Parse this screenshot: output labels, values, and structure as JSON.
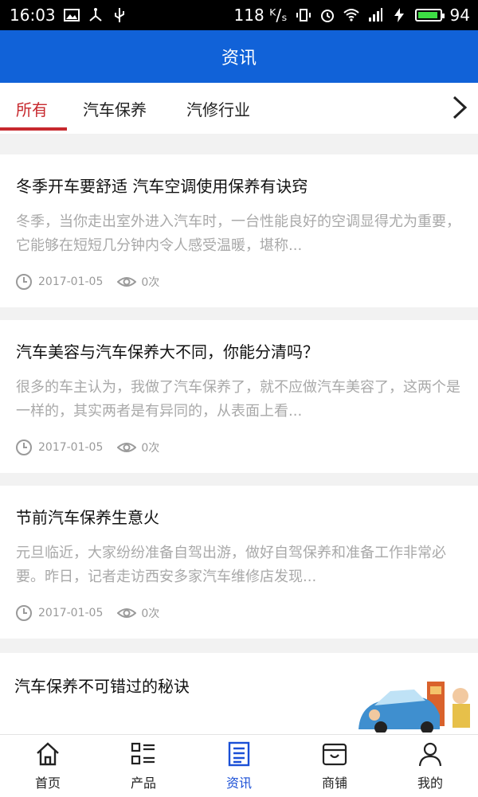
{
  "status": {
    "time": "16:03",
    "speed": "118 ᴷ/ₛ",
    "battery": "94",
    "battery_level": 0.94
  },
  "header": {
    "title": "资讯"
  },
  "tabs": [
    {
      "label": "所有",
      "active": true
    },
    {
      "label": "汽车保养",
      "active": false
    },
    {
      "label": "汽修行业",
      "active": false
    }
  ],
  "articles": [
    {
      "title": "冬季开车要舒适 汽车空调使用保养有诀窍",
      "summary": "冬季，当你走出室外进入汽车时，一台性能良好的空调显得尤为重要，它能够在短短几分钟内令人感受温暖，堪称...",
      "date": "2017-01-05",
      "views": "0次"
    },
    {
      "title": "汽车美容与汽车保养大不同，你能分清吗？",
      "summary": "很多的车主认为，我做了汽车保养了，就不应做汽车美容了，这两个是一样的，其实两者是有异同的，从表面上看...",
      "date": "2017-01-05",
      "views": "0次"
    },
    {
      "title": "节前汽车保养生意火",
      "summary": "元旦临近，大家纷纷准备自驾出游，做好自驾保养和准备工作非常必要。昨日，记者走访西安多家汽车维修店发现...",
      "date": "2017-01-05",
      "views": "0次"
    },
    {
      "title": "汽车保养不可错过的秘诀"
    }
  ],
  "bottom_nav": [
    {
      "label": "首页",
      "icon": "home-icon"
    },
    {
      "label": "产品",
      "icon": "product-list-icon"
    },
    {
      "label": "资讯",
      "icon": "news-icon",
      "active": true
    },
    {
      "label": "商铺",
      "icon": "shop-icon"
    },
    {
      "label": "我的",
      "icon": "user-icon"
    }
  ],
  "colors": {
    "header_bg": "#1162d8",
    "active_tab": "#c7282d",
    "active_nav": "#1a4fd6"
  }
}
